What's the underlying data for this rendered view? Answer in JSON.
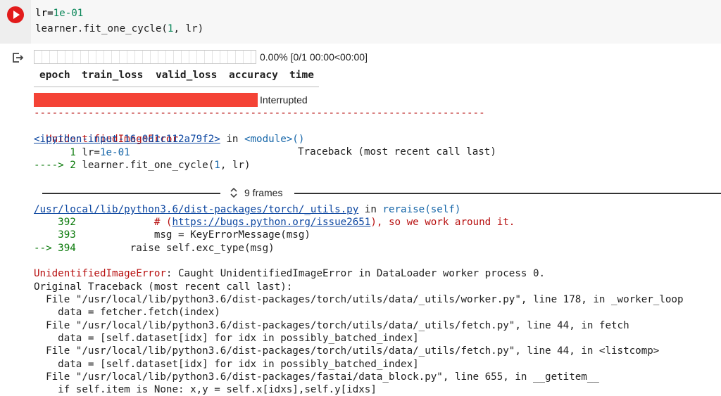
{
  "cell": {
    "code_line1_a": "lr=",
    "code_line1_b": "1e-01",
    "code_line2_a": "learner.fit_one_cycle(",
    "code_line2_b": "1",
    "code_line2_c": ", lr)"
  },
  "progress": {
    "top_text": "0.00% [0/1 00:00<00:00]",
    "top_fraction": 0.0,
    "bottom_text": "Interrupted",
    "bottom_fraction": 1.0
  },
  "metrics_header": [
    "epoch",
    "train_loss",
    "valid_loss",
    "accuracy",
    "time"
  ],
  "traceback": {
    "dashes": "---------------------------------------------------------------------------",
    "error_name": "UnidentifiedImageError",
    "tb_label": "Traceback (most recent call last)",
    "input_link": "<ipython-input-16-0d1c112a79f2>",
    "in_word": " in ",
    "module": "<module>()",
    "l1_num": "      1 ",
    "l1_a": "lr=",
    "l1_b": "1e-01",
    "l2_arrow": "----> 2 ",
    "l2_a": "learner.fit_one_cycle(",
    "l2_b": "1",
    "l2_c": ", lr)",
    "frames": "9 frames",
    "file_link": "/usr/local/lib/python3.6/dist-packages/torch/_utils.py",
    "file_in": " in ",
    "file_func": "reraise(self)",
    "f392_num": "    392 ",
    "f392_a": "            # (",
    "f392_link": "https://bugs.python.org/issue2651",
    "f392_b": "), so we work around it.",
    "f393_num": "    393 ",
    "f393_a": "            msg = KeyErrorMessage(msg)",
    "f394_arrow": "--> 394 ",
    "f394_a": "        raise self.exc_type(msg)",
    "err2_name": "UnidentifiedImageError",
    "err2_msg": ": Caught UnidentifiedImageError in DataLoader worker process 0.",
    "orig_tb": "Original Traceback (most recent call last):",
    "t1": "  File \"/usr/local/lib/python3.6/dist-packages/torch/utils/data/_utils/worker.py\", line 178, in _worker_loop",
    "t2": "    data = fetcher.fetch(index)",
    "t3": "  File \"/usr/local/lib/python3.6/dist-packages/torch/utils/data/_utils/fetch.py\", line 44, in fetch",
    "t4": "    data = [self.dataset[idx] for idx in possibly_batched_index]",
    "t5": "  File \"/usr/local/lib/python3.6/dist-packages/torch/utils/data/_utils/fetch.py\", line 44, in <listcomp>",
    "t6": "    data = [self.dataset[idx] for idx in possibly_batched_index]",
    "t7": "  File \"/usr/local/lib/python3.6/dist-packages/fastai/data_block.py\", line 655, in __getitem__",
    "t8": "    if self.item is None: x,y = self.x[idxs],self.y[idxs]"
  },
  "colors": {
    "run": "#e21b1b",
    "progress_fill": "#f44336",
    "error": "#b70f0f",
    "link": "#0d47a1"
  }
}
